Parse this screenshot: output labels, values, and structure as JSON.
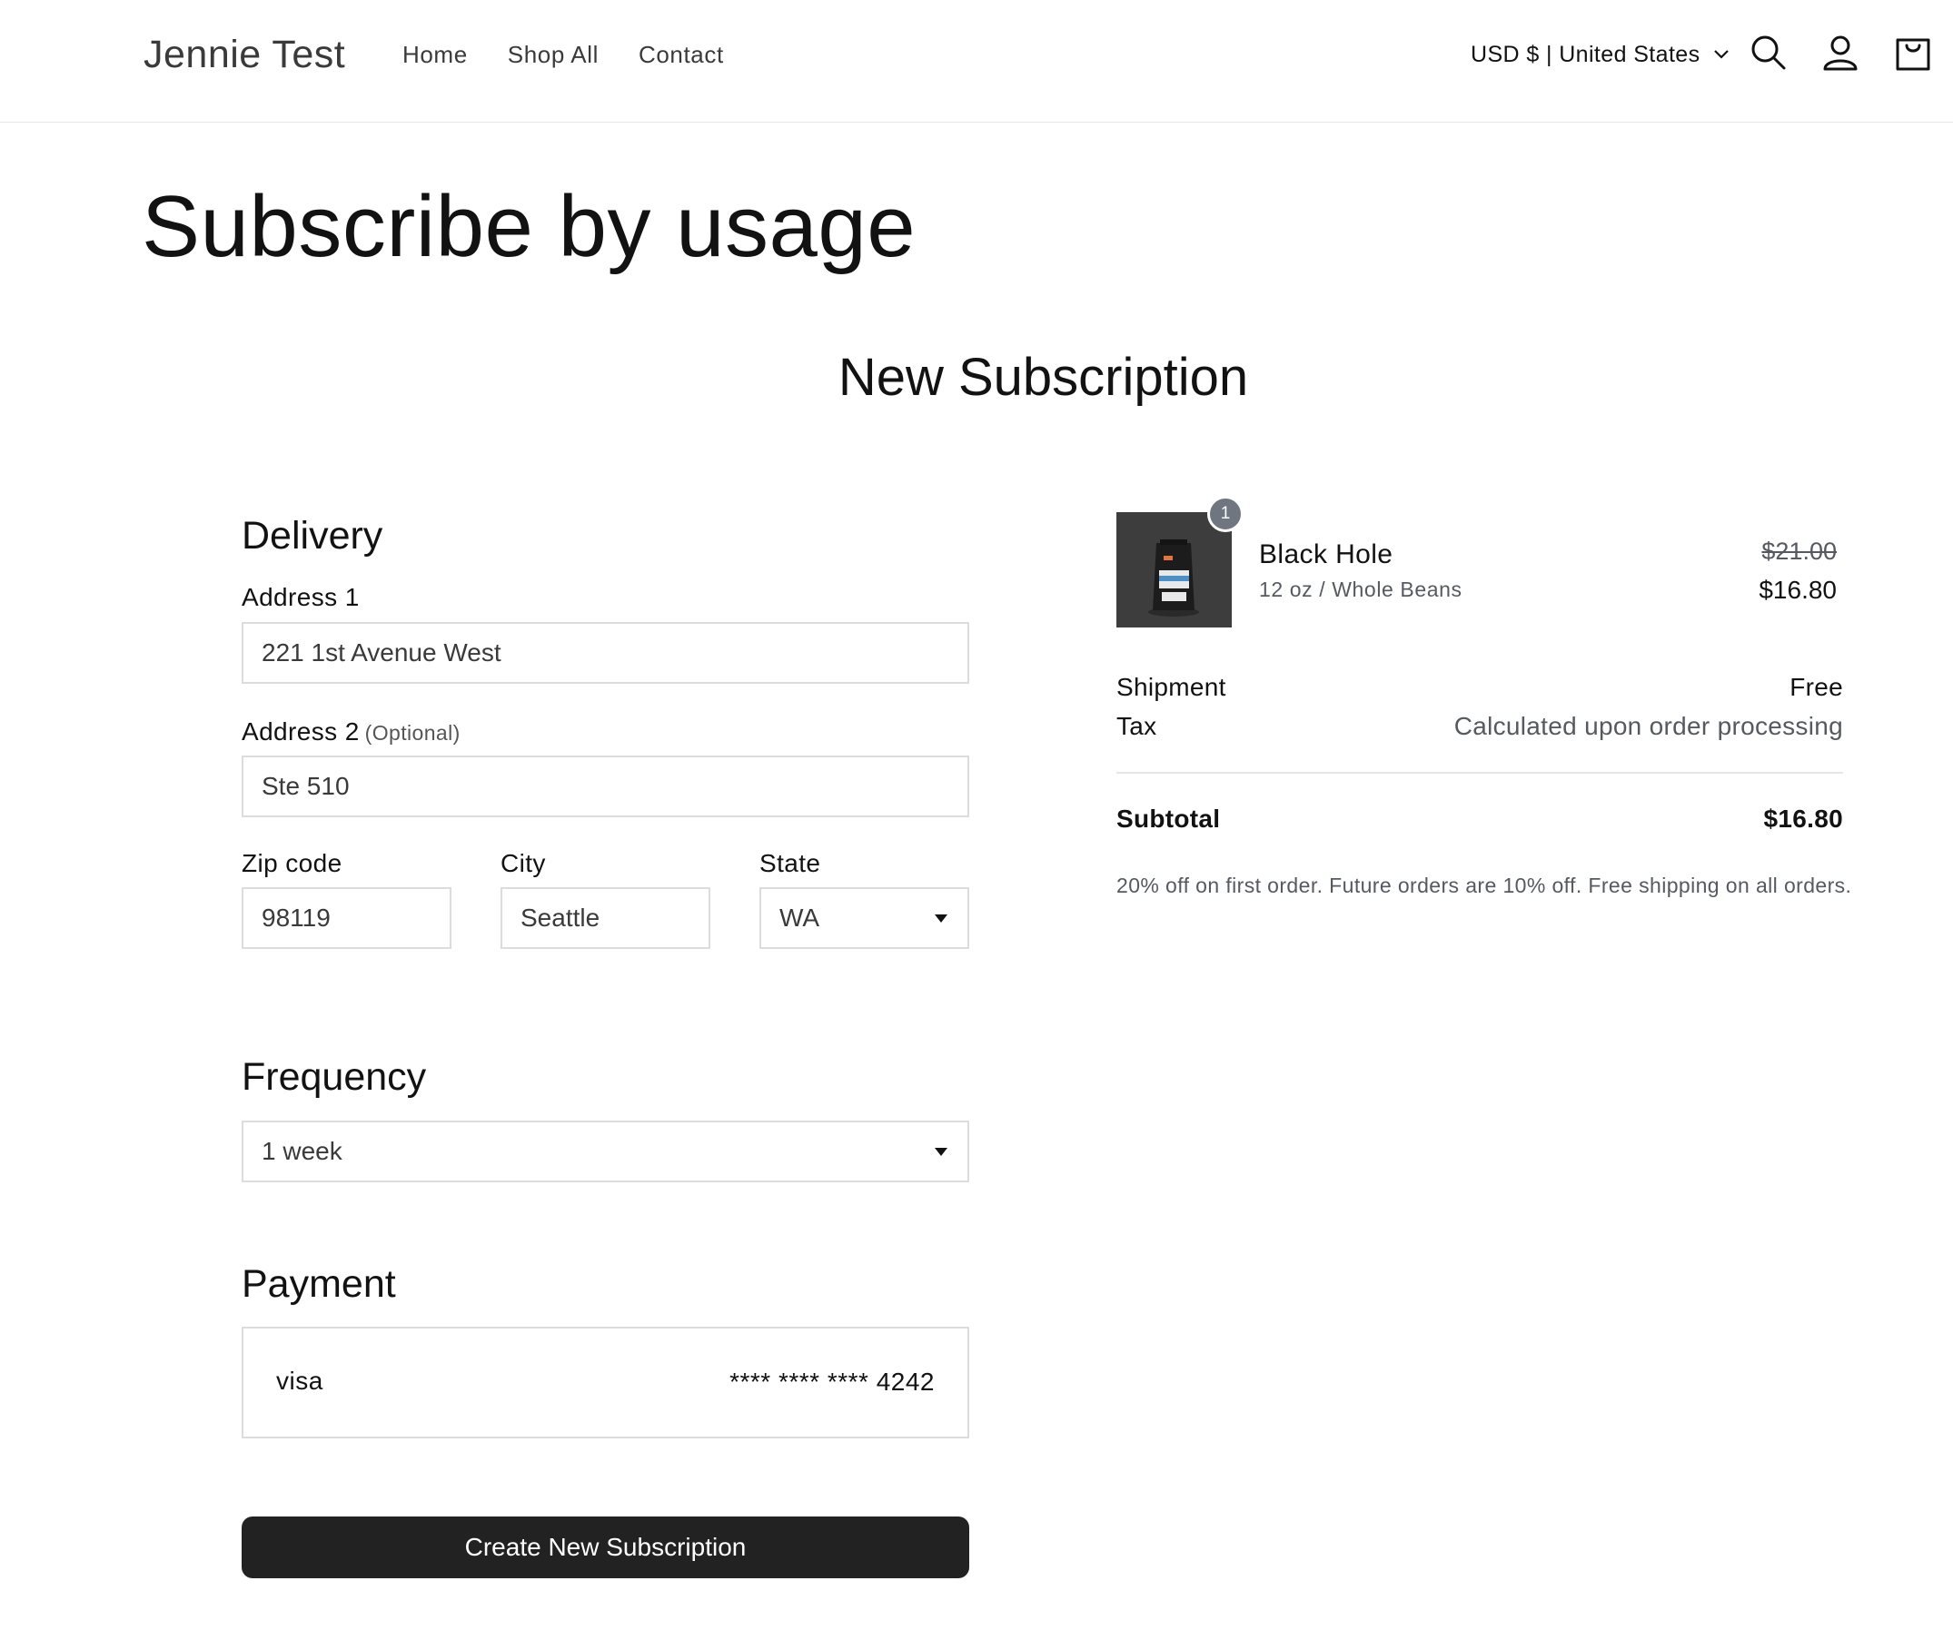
{
  "header": {
    "logo": "Jennie Test",
    "nav": [
      "Home",
      "Shop All",
      "Contact"
    ],
    "locale": "USD $ | United States",
    "icons": [
      "search-icon",
      "account-icon",
      "cart-icon"
    ]
  },
  "page": {
    "title": "Subscribe by usage",
    "section_title": "New Subscription"
  },
  "delivery": {
    "heading": "Delivery",
    "address1_label": "Address 1",
    "address1_value": "221 1st Avenue West",
    "address2_label": "Address 2",
    "address2_optional": "(Optional)",
    "address2_value": "Ste 510",
    "zip_label": "Zip code",
    "zip_value": "98119",
    "city_label": "City",
    "city_value": "Seattle",
    "state_label": "State",
    "state_value": "WA"
  },
  "frequency": {
    "heading": "Frequency",
    "value": "1 week"
  },
  "payment": {
    "heading": "Payment",
    "brand": "visa",
    "number": "**** **** **** 4242"
  },
  "actions": {
    "submit_label": "Create New Subscription"
  },
  "summary": {
    "product_name": "Black Hole",
    "variant": "12 oz / Whole Beans",
    "quantity": "1",
    "price_old": "$21.00",
    "price_new": "$16.80",
    "shipment_label": "Shipment",
    "shipment_value": "Free",
    "tax_label": "Tax",
    "tax_value": "Calculated upon order processing",
    "subtotal_label": "Subtotal",
    "subtotal_value": "$16.80",
    "note": "20% off on first order. Future orders are 10% off. Free shipping on all orders."
  }
}
